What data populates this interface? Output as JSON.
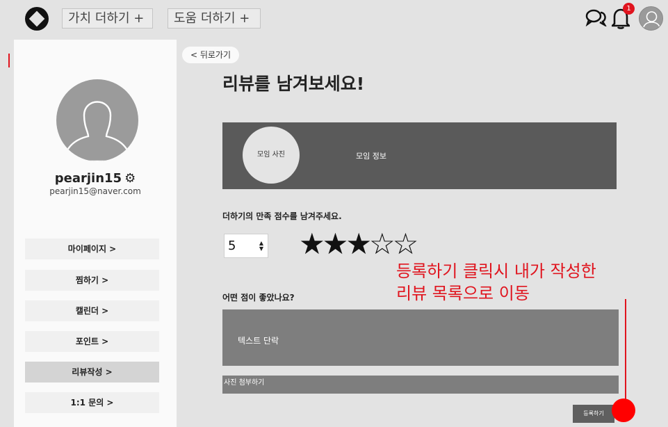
{
  "header": {
    "logo_icon": "aperture-logo-icon",
    "nav": [
      {
        "label": "가치 더하기 +"
      },
      {
        "label": "도움 더하기 +"
      }
    ],
    "chat_icon": "chat-bubbles-icon",
    "bell_icon": "bell-icon",
    "notification_count": "1",
    "avatar_icon": "user-avatar-icon"
  },
  "sidebar": {
    "username": "pearjin15",
    "settings_icon": "gear-icon",
    "email": "pearjin15@naver.com",
    "menu": [
      {
        "label": "마이페이지 >"
      },
      {
        "label": "찜하기 >"
      },
      {
        "label": "캘린더 >"
      },
      {
        "label": "포인트 >"
      },
      {
        "label": "리뷰작성 >"
      },
      {
        "label": "1:1 문의 >"
      }
    ],
    "active_menu": "리뷰작성 >"
  },
  "main": {
    "back_label": "< 뒤로가기",
    "title": "리뷰를 남겨보세요!",
    "group": {
      "photo_label": "모임 사진",
      "info_label": "모임 정보"
    },
    "score_label": "더하기의 만족 점수를 남겨주세요.",
    "score_value": "5",
    "rating": {
      "filled": 3,
      "total": 5
    },
    "good_label": "어떤 점이 좋았나요?",
    "text_area_label": "텍스트 단락",
    "attach_label": "사진 첨부하기",
    "submit_label": "등록하기"
  },
  "annotation": {
    "line1": "등록하기 클릭시 내가 작성한",
    "line2": "리뷰 목록으로 이동"
  },
  "colors": {
    "accent_red": "#e0141e",
    "card_dark": "#5a5a5a",
    "field_gray": "#7e7e7e"
  }
}
